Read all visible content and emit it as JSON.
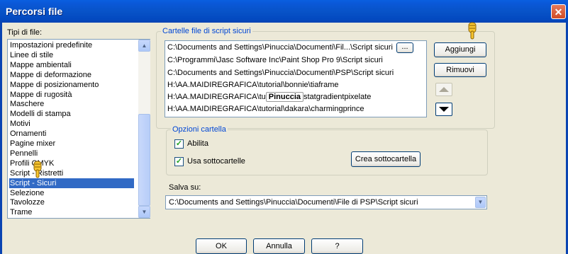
{
  "window": {
    "title": "Percorsi file"
  },
  "left": {
    "label": "Tipi di file:",
    "items": [
      "Impostazioni predefinite",
      "Linee di stile",
      "Mappe ambientali",
      "Mappe di deformazione",
      "Mappe di posizionamento",
      "Mappe di rugosità",
      "Maschere",
      "Modelli di stampa",
      "Motivi",
      "Ornamenti",
      "Pagine mixer",
      "Pennelli",
      "Profili CMYK",
      "Script - Ristretti",
      "Script - Sicuri",
      "Selezione",
      "Tavolozze",
      "Trame"
    ],
    "selected": "Script - Sicuri"
  },
  "folders": {
    "label": "Cartelle file di script sicuri",
    "paths": [
      "C:\\Documents and Settings\\Pinuccia\\Documenti\\Fil...\\Script sicuri",
      "C:\\Programmi\\Jasc Software Inc\\Paint Shop Pro 9\\Script sicuri",
      "C:\\Documents and Settings\\Pinuccia\\Documenti\\PSP\\Script sicuri",
      "H:\\AA.MAIDIREGRAFICA\\tutorial\\bonnie\\tiaframe",
      "H:\\AA.MAIDIREGRAFICA\\tu",
      "H:\\AA.MAIDIREGRAFICA\\tutorial\\dakara\\charmingprince"
    ],
    "path5_tail": "statgradientpixelate",
    "watermark": "Pinuccia",
    "browse_label": "...",
    "add_label": "Aggiungi",
    "remove_label": "Rimuovi"
  },
  "options": {
    "label": "Opzioni cartella",
    "enable_label": "Abilita",
    "enable_checked": true,
    "subfolders_label": "Usa sottocartelle",
    "subfolders_checked": true,
    "create_subfolder_label": "Crea sottocartella"
  },
  "save": {
    "label": "Salva su:",
    "value": "C:\\Documents and Settings\\Pinuccia\\Documenti\\File di PSP\\Script sicuri"
  },
  "footer": {
    "ok": "OK",
    "cancel": "Annulla",
    "help": "?"
  },
  "colors": {
    "accent": "#0046d5",
    "selection": "#316ac5",
    "titlebar": "#0853c8"
  },
  "icons": {
    "close": "close-icon",
    "up": "arrow-up-icon",
    "down": "arrow-down-icon",
    "pointer": "hand-pointer-icon"
  }
}
